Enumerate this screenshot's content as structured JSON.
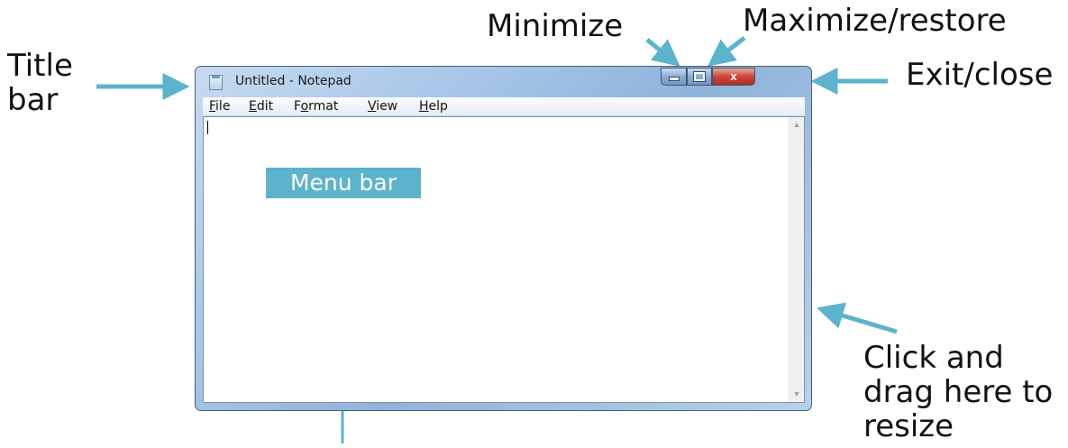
{
  "annotations": {
    "title_bar": "Title\nbar",
    "minimize": "Minimize",
    "maximize_restore": "Maximize/restore",
    "exit_close": "Exit/close",
    "resize": "Click and\ndrag here to\nresize",
    "menu_bar": "Menu bar"
  },
  "window": {
    "title": "Untitled - Notepad",
    "close_glyph": "x"
  },
  "menu": [
    {
      "underlined": "F",
      "rest": "ile"
    },
    {
      "underlined": "E",
      "rest": "dit"
    },
    {
      "lead": "F",
      "underlined": "o",
      "rest": "rmat"
    },
    {
      "underlined": "V",
      "rest": "iew"
    },
    {
      "underlined": "H",
      "rest": "elp"
    }
  ],
  "scrollbar": {
    "up_glyph": "▲",
    "down_glyph": "▼"
  },
  "colors": {
    "annotation_accent": "#5bb3cc"
  }
}
